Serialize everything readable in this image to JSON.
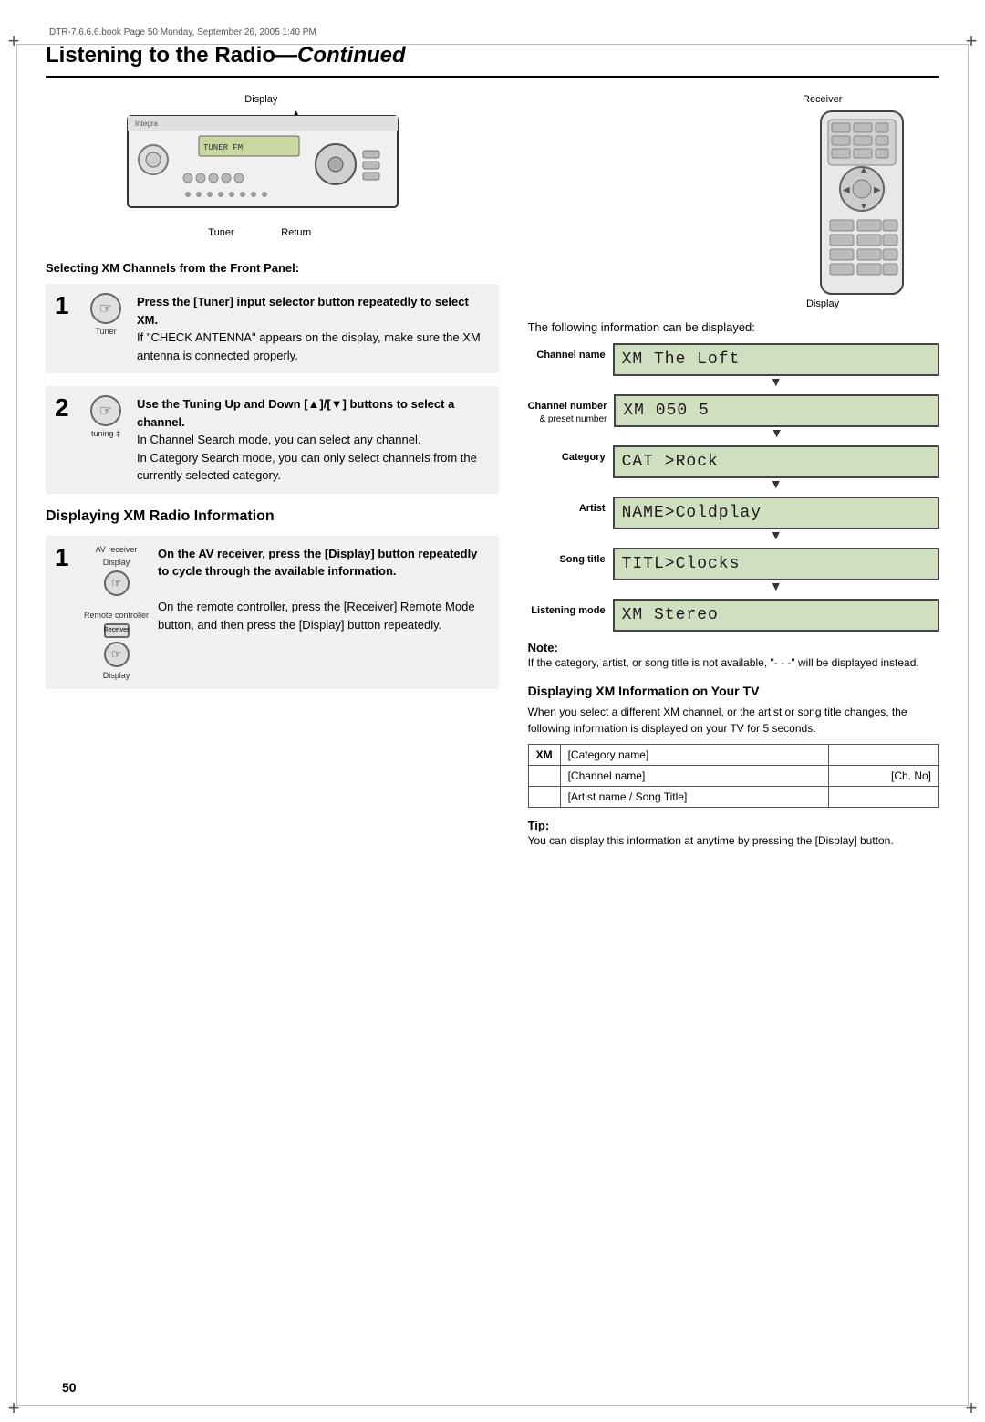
{
  "page": {
    "file_info": "DTR-7.6.6.6.book  Page 50  Monday, September 26, 2005  1:40 PM",
    "title": "Listening to the Radio—",
    "title_italic": "Continued",
    "page_number": "50"
  },
  "left_diagram": {
    "display_label": "Display",
    "up_down_arrows": "▲/▼",
    "tuner_label": "Tuner",
    "return_label": "Return"
  },
  "right_diagram": {
    "receiver_label": "Receiver",
    "display_label": "Display"
  },
  "section1": {
    "heading": "Selecting XM Channels from the Front Panel:",
    "step1_num": "1",
    "step1_icon_label": "Tuner",
    "step1_bold": "Press the [Tuner] input selector button repeatedly to select XM.",
    "step1_body": "If \"CHECK ANTENNA\" appears on the display, make sure the XM antenna is connected properly.",
    "step2_num": "2",
    "step2_icon_label": "tuning ‡",
    "step2_bold": "Use the Tuning Up and Down [▲]/[▼] buttons to select a channel.",
    "step2_body1": "In Channel Search mode, you can select any channel.",
    "step2_body2": "In Category Search mode, you can only select channels from the currently selected category."
  },
  "right_info_heading": "The following information can be displayed:",
  "xm_displays": [
    {
      "label": "Channel name",
      "sub_label": "",
      "screen_text": "XM  The Loft",
      "show_arrow": true
    },
    {
      "label": "Channel number",
      "sub_label": "& preset number",
      "screen_text": "XM       050  5",
      "show_arrow": true
    },
    {
      "label": "Category",
      "sub_label": "",
      "screen_text": "CAT >Rock",
      "show_arrow": true
    },
    {
      "label": "Artist",
      "sub_label": "",
      "screen_text": "NAME>Coldplay",
      "show_arrow": true
    },
    {
      "label": "Song title",
      "sub_label": "",
      "screen_text": "TITL>Clocks",
      "show_arrow": true
    },
    {
      "label": "Listening mode",
      "sub_label": "",
      "screen_text": "XM  Stereo",
      "show_arrow": true
    }
  ],
  "section2": {
    "heading": "Displaying XM Radio Information",
    "step1_num": "1",
    "av_label": "AV receiver",
    "display_label1": "Display",
    "remote_label": "Remote controller",
    "receiver_label": "Receiver",
    "display_label2": "Display",
    "step1_bold": "On the AV receiver, press the [Display] button repeatedly to cycle through the available information.",
    "step2_text1": "On the remote controller, press the [Receiver] Remote Mode button, and then press the [Display] button repeatedly."
  },
  "note": {
    "title": "Note:",
    "text": "If the category, artist, or song title is not available, \"- - -\" will be displayed instead."
  },
  "xm_tv_section": {
    "heading": "Displaying XM Information on Your TV",
    "intro": "When you select a different XM channel, or the artist or song title changes, the following information is displayed on your TV for 5 seconds.",
    "table": [
      {
        "col1": "XM",
        "col2": "[Category name]",
        "col3": ""
      },
      {
        "col1": "",
        "col2": "[Channel name]",
        "col3": "[Ch. No]"
      },
      {
        "col1": "",
        "col2": "[Artist name / Song Title]",
        "col3": ""
      }
    ]
  },
  "tip": {
    "title": "Tip:",
    "text": "You can display this information at anytime by pressing the [Display] button."
  }
}
